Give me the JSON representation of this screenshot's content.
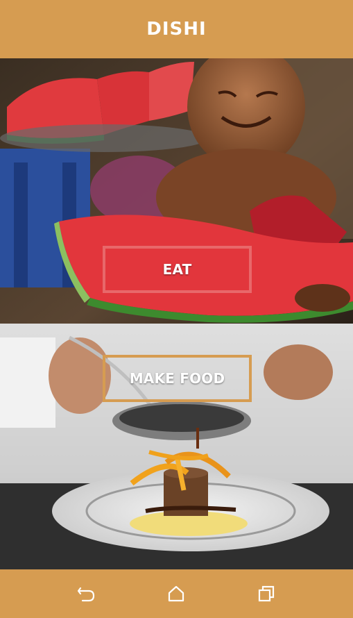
{
  "app_bar": {
    "title": "DISHI"
  },
  "panels": {
    "eat": {
      "label": "EAT"
    },
    "make_food": {
      "label": "MAKE FOOD"
    }
  },
  "nav": {
    "icons": [
      "back-icon",
      "home-icon",
      "recents-icon"
    ]
  },
  "colors": {
    "brand": "#d69c51",
    "eat_border": "#e8686a",
    "make_border": "#d69c51"
  }
}
